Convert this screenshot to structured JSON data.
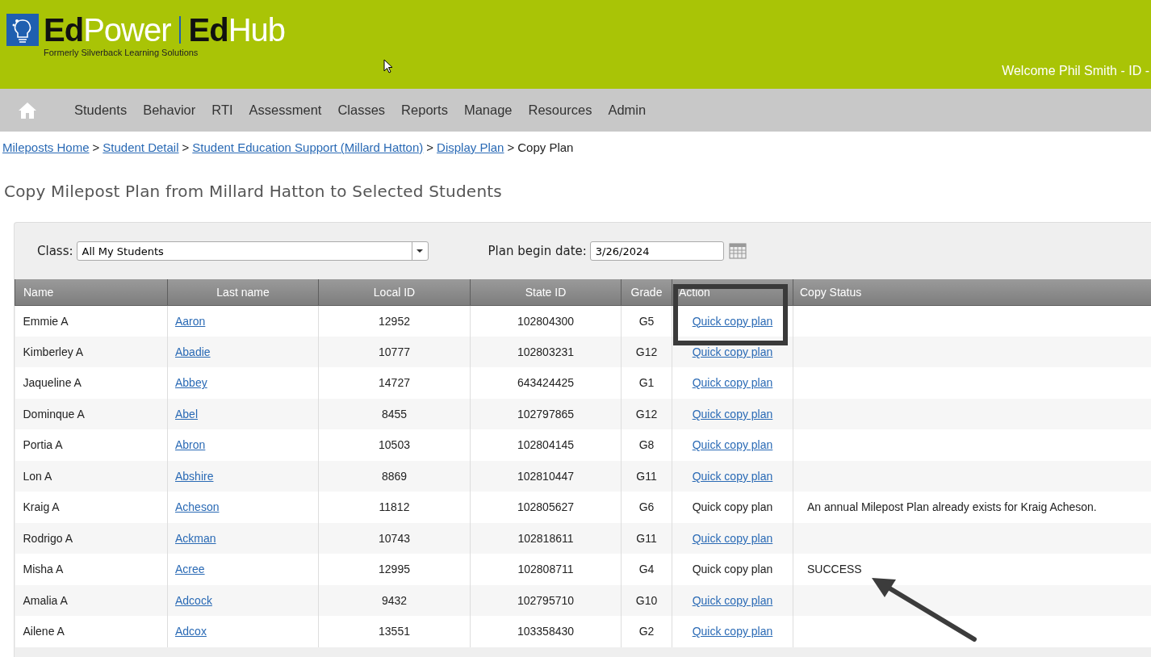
{
  "header": {
    "logo_left": [
      {
        "text": "Ed",
        "kind": "dark"
      },
      {
        "text": "Power",
        "kind": "light"
      }
    ],
    "logo_right": [
      {
        "text": "Ed",
        "kind": "dark"
      },
      {
        "text": "Hub",
        "kind": "light"
      }
    ],
    "tagline": "Formerly Silverback Learning Solutions",
    "welcome": "Welcome Phil Smith - ID -"
  },
  "nav": [
    "Students",
    "Behavior",
    "RTI",
    "Assessment",
    "Classes",
    "Reports",
    "Manage",
    "Resources",
    "Admin"
  ],
  "breadcrumb": [
    {
      "text": "Mileposts Home",
      "kind": "link"
    },
    {
      "text": "Student Detail",
      "kind": "link"
    },
    {
      "text": "Student Education Support (Millard Hatton)",
      "kind": "link"
    },
    {
      "text": "Display Plan",
      "kind": "link"
    },
    {
      "text": "Copy Plan",
      "kind": "current"
    }
  ],
  "separator": ">",
  "page_title": "Copy Milepost Plan from Millard Hatton to Selected Students",
  "filters": {
    "class_label": "Class:",
    "class_value": "All My Students",
    "date_label": "Plan begin date:",
    "date_value": "3/26/2024"
  },
  "table": {
    "columns": [
      "Name",
      "Last name",
      "Local ID",
      "State ID",
      "Grade",
      "Action",
      "Copy Status"
    ],
    "rows": [
      {
        "name": "Emmie A",
        "last_name": "Aaron",
        "local_id": "12952",
        "state_id": "102804300",
        "grade": "G5",
        "action": "Quick copy plan",
        "action_is_link": true,
        "status": ""
      },
      {
        "name": "Kimberley A",
        "last_name": "Abadie",
        "local_id": "10777",
        "state_id": "102803231",
        "grade": "G12",
        "action": "Quick copy plan",
        "action_is_link": true,
        "status": ""
      },
      {
        "name": "Jaqueline A",
        "last_name": "Abbey",
        "local_id": "14727",
        "state_id": "643424425",
        "grade": "G1",
        "action": "Quick copy plan",
        "action_is_link": true,
        "status": ""
      },
      {
        "name": "Dominque A",
        "last_name": "Abel",
        "local_id": "8455",
        "state_id": "102797865",
        "grade": "G12",
        "action": "Quick copy plan",
        "action_is_link": true,
        "status": ""
      },
      {
        "name": "Portia A",
        "last_name": "Abron",
        "local_id": "10503",
        "state_id": "102804145",
        "grade": "G8",
        "action": "Quick copy plan",
        "action_is_link": true,
        "status": ""
      },
      {
        "name": "Lon A",
        "last_name": "Abshire",
        "local_id": "8869",
        "state_id": "102810447",
        "grade": "G11",
        "action": "Quick copy plan",
        "action_is_link": true,
        "status": ""
      },
      {
        "name": "Kraig A",
        "last_name": "Acheson",
        "local_id": "11812",
        "state_id": "102805627",
        "grade": "G6",
        "action": "Quick copy plan",
        "action_is_link": false,
        "status": "An annual Milepost Plan already exists for Kraig Acheson."
      },
      {
        "name": "Rodrigo A",
        "last_name": "Ackman",
        "local_id": "10743",
        "state_id": "102818611",
        "grade": "G11",
        "action": "Quick copy plan",
        "action_is_link": true,
        "status": ""
      },
      {
        "name": "Misha A",
        "last_name": "Acree",
        "local_id": "12995",
        "state_id": "102808711",
        "grade": "G4",
        "action": "Quick copy plan",
        "action_is_link": false,
        "status": "SUCCESS"
      },
      {
        "name": "Amalia A",
        "last_name": "Adcock",
        "local_id": "9432",
        "state_id": "102795710",
        "grade": "G10",
        "action": "Quick copy plan",
        "action_is_link": true,
        "status": ""
      },
      {
        "name": "Ailene A",
        "last_name": "Adcox",
        "local_id": "13551",
        "state_id": "103358430",
        "grade": "G2",
        "action": "Quick copy plan",
        "action_is_link": true,
        "status": ""
      }
    ]
  }
}
